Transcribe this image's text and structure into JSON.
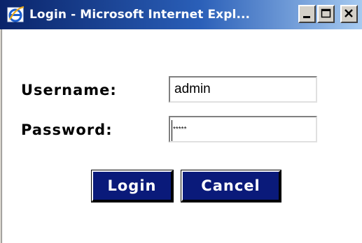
{
  "window": {
    "title": "Login - Microsoft Internet Expl...",
    "title_icon": "internet-explorer-icon",
    "controls": {
      "minimize": "minimize-icon",
      "maximize": "maximize-icon",
      "close": "close-icon"
    }
  },
  "form": {
    "username_label": "Username:",
    "username_value": "admin",
    "password_label": "Password:",
    "password_value": "*****",
    "login_label": "Login",
    "cancel_label": "Cancel"
  },
  "colors": {
    "titlebar_start": "#0a246a",
    "titlebar_end": "#a6caf0",
    "button_bg": "#0a1a7a",
    "button_text": "#ffffff"
  }
}
